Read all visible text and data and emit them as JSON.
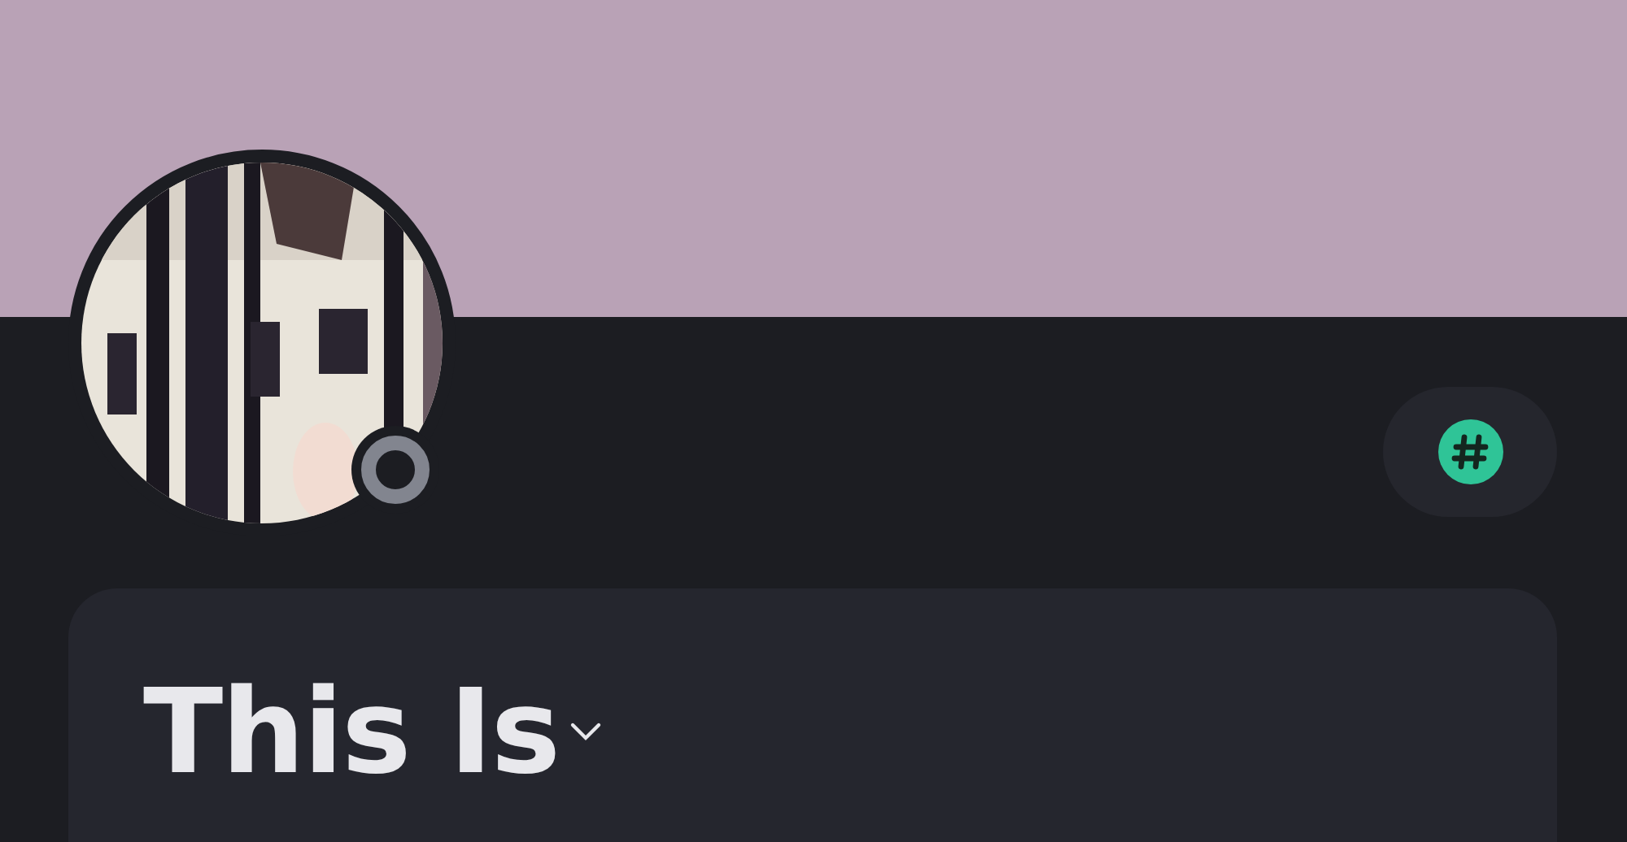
{
  "profile": {
    "display_name": "This Is",
    "online": false,
    "name_expanded": false
  }
}
